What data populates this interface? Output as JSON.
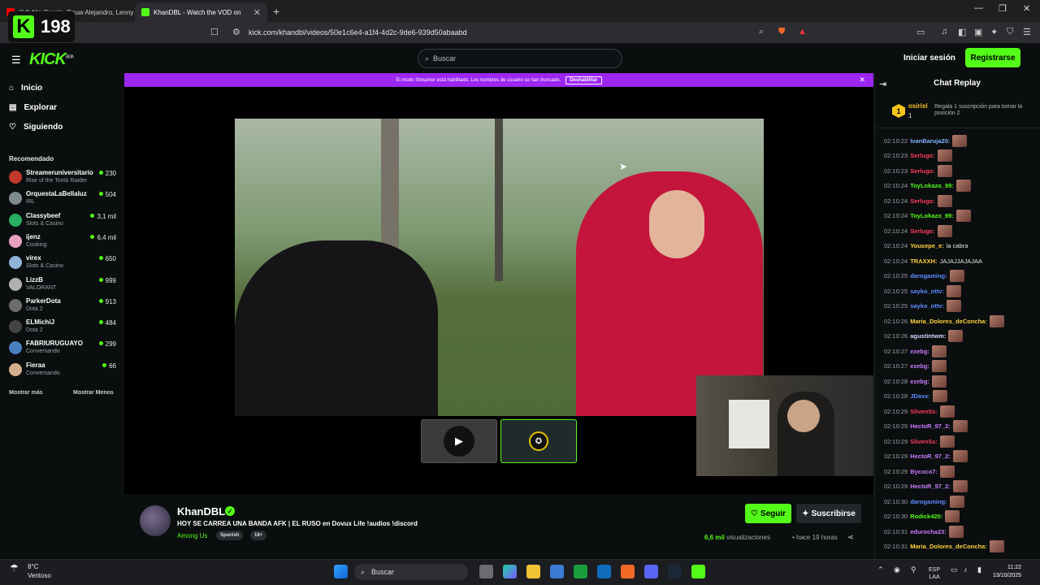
{
  "browser": {
    "tabs": [
      {
        "label": "(14) Nio García, Rauw Alejandro, Lenny"
      },
      {
        "label": "KhanDBL - Watch the VOD on"
      }
    ],
    "url": "kick.com/khandbl/videos/50e1c6e4-a1f4-4d2c-9de6-939d50abaabd",
    "overlay_count": "198"
  },
  "header": {
    "logo": "KICK",
    "logo_sup": "BETA",
    "search_placeholder": "Buscar",
    "login": "Iniciar sesión",
    "register": "Registrarse"
  },
  "sidebar": {
    "nav": [
      {
        "label": "Inicio",
        "icon": "home-icon"
      },
      {
        "label": "Explorar",
        "icon": "compass-icon"
      },
      {
        "label": "Siguiendo",
        "icon": "heart-icon"
      }
    ],
    "recommended_title": "Recomendado",
    "recommended": [
      {
        "name": "Streameruniversitario",
        "category": "Rise of the Tomb Raider",
        "viewers": "230",
        "color": "#c0392b"
      },
      {
        "name": "OrquestaLaBellaluz",
        "category": "IRL",
        "viewers": "504",
        "color": "#7f8c8d"
      },
      {
        "name": "Classybeef",
        "category": "Slots & Casino",
        "viewers": "3,1 mil",
        "color": "#27ae60"
      },
      {
        "name": "ijenz",
        "category": "Cooking",
        "viewers": "6,4 mil",
        "color": "#e8a0c0"
      },
      {
        "name": "virex",
        "category": "Slots & Casino",
        "viewers": "650",
        "color": "#8fb3d9"
      },
      {
        "name": "LizzB",
        "category": "VALORANT",
        "viewers": "999",
        "color": "#b0b0b0"
      },
      {
        "name": "ParkerDota",
        "category": "Dota 2",
        "viewers": "913",
        "color": "#6d6d6d"
      },
      {
        "name": "ELMichiJ",
        "category": "Dota 2",
        "viewers": "484",
        "color": "#444"
      },
      {
        "name": "FABRIURUGUAYO",
        "category": "Conversando",
        "viewers": "299",
        "color": "#4a7fc1"
      },
      {
        "name": "Fieraa",
        "category": "Conversando",
        "viewers": "66",
        "color": "#d4b08c"
      }
    ],
    "show_more": "Mostrar más",
    "show_less": "Mostrar Menos"
  },
  "banner": {
    "text": "El modo Streamer está habilitado. Los nombres de usuario se han truncado.",
    "button": "Deshabilitar"
  },
  "video_info": {
    "channel": "KhanDBL",
    "title": "HOY SE CARREA UNA BANDA AFK | EL RUSO en Dovux Life !audios !discord",
    "category": "Among Us",
    "tags": [
      "Spanish",
      "18+"
    ],
    "follow": "Seguir",
    "subscribe": "Suscribirse",
    "views_count": "6,6 mil",
    "views_label": "visualizaciones",
    "ago": "hace 19 horas"
  },
  "chat": {
    "title": "Chat Replay",
    "pinned": {
      "badge": "1",
      "user": "osirisl",
      "rank": "1",
      "message": "Regala 1 suscripción para tomar la posición 2"
    },
    "messages": [
      {
        "time": "02:10:22",
        "user": "IvanBaruja20:",
        "color": "#7fb3ff",
        "text": "",
        "emote": true
      },
      {
        "time": "02:10:23",
        "user": "Serlugo:",
        "color": "#ff3b5c",
        "text": "",
        "emote": true
      },
      {
        "time": "02:10:23",
        "user": "Serlugo:",
        "color": "#ff3b5c",
        "text": "",
        "emote": true
      },
      {
        "time": "02:10:24",
        "user": "ToyLokazo_99:",
        "color": "#53fc18",
        "text": "",
        "emote": true
      },
      {
        "time": "02:10:24",
        "user": "Serlugo:",
        "color": "#ff3b5c",
        "text": "",
        "emote": true
      },
      {
        "time": "02:10:24",
        "user": "ToyLokazo_99:",
        "color": "#53fc18",
        "text": "",
        "emote": true
      },
      {
        "time": "02:10:24",
        "user": "Serlugo:",
        "color": "#ff3b5c",
        "text": "",
        "emote": true
      },
      {
        "time": "02:10:24",
        "user": "Yousepe_e:",
        "color": "#ffd23f",
        "text": "la cabra",
        "emote": false
      },
      {
        "time": "02:10:24",
        "user": "TRAXXH:",
        "color": "#ffd23f",
        "text": "JAJAJJAJAJAA",
        "emote": false
      },
      {
        "time": "02:10:25",
        "user": "darogaming:",
        "color": "#5b8cff",
        "text": "",
        "emote": true
      },
      {
        "time": "02:10:25",
        "user": "sayko_ottv:",
        "color": "#5b8cff",
        "text": "",
        "emote": true
      },
      {
        "time": "02:10:25",
        "user": "sayko_ottv:",
        "color": "#5b8cff",
        "text": "",
        "emote": true
      },
      {
        "time": "02:10:26",
        "user": "Maria_Dolores_deConcha:",
        "color": "#ffd23f",
        "text": "",
        "emote": true
      },
      {
        "time": "02:10:26",
        "user": "agustintwm:",
        "color": "#cfd8ff",
        "text": "",
        "emote": true
      },
      {
        "time": "02:10:27",
        "user": "ezebg:",
        "color": "#c77dff",
        "text": "",
        "emote": true
      },
      {
        "time": "02:10:27",
        "user": "ezebg:",
        "color": "#c77dff",
        "text": "",
        "emote": true
      },
      {
        "time": "02:10:28",
        "user": "ezebg:",
        "color": "#c77dff",
        "text": "",
        "emote": true
      },
      {
        "time": "02:10:28",
        "user": "JDavx:",
        "color": "#5b8cff",
        "text": "",
        "emote": true
      },
      {
        "time": "02:10:29",
        "user": "SlivenSs:",
        "color": "#ff3b5c",
        "text": "",
        "emote": true
      },
      {
        "time": "02:10:29",
        "user": "HectoR_97_2:",
        "color": "#c77dff",
        "text": "",
        "emote": true
      },
      {
        "time": "02:10:29",
        "user": "SlivenSs:",
        "color": "#ff3b5c",
        "text": "",
        "emote": true
      },
      {
        "time": "02:10:29",
        "user": "HectoR_97_2:",
        "color": "#c77dff",
        "text": "",
        "emote": true
      },
      {
        "time": "02:10:29",
        "user": "Bycoco7:",
        "color": "#c77dff",
        "text": "",
        "emote": true
      },
      {
        "time": "02:10:29",
        "user": "HectoR_97_2:",
        "color": "#c77dff",
        "text": "",
        "emote": true
      },
      {
        "time": "02:10:30",
        "user": "darogaming:",
        "color": "#5b8cff",
        "text": "",
        "emote": true
      },
      {
        "time": "02:10:30",
        "user": "Rodick420:",
        "color": "#53fc18",
        "text": "",
        "emote": true
      },
      {
        "time": "02:10:31",
        "user": "edurocha23:",
        "color": "#c77dff",
        "text": "",
        "emote": true
      },
      {
        "time": "02:10:31",
        "user": "Maria_Dolores_deConcha:",
        "color": "#ffd23f",
        "text": "",
        "emote": true
      }
    ]
  },
  "taskbar": {
    "temp": "8°C",
    "weather": "Ventoso",
    "search": "Buscar",
    "lang": "ESP",
    "lang2": "LAA",
    "time": "11:22",
    "date": "13/10/2025"
  }
}
